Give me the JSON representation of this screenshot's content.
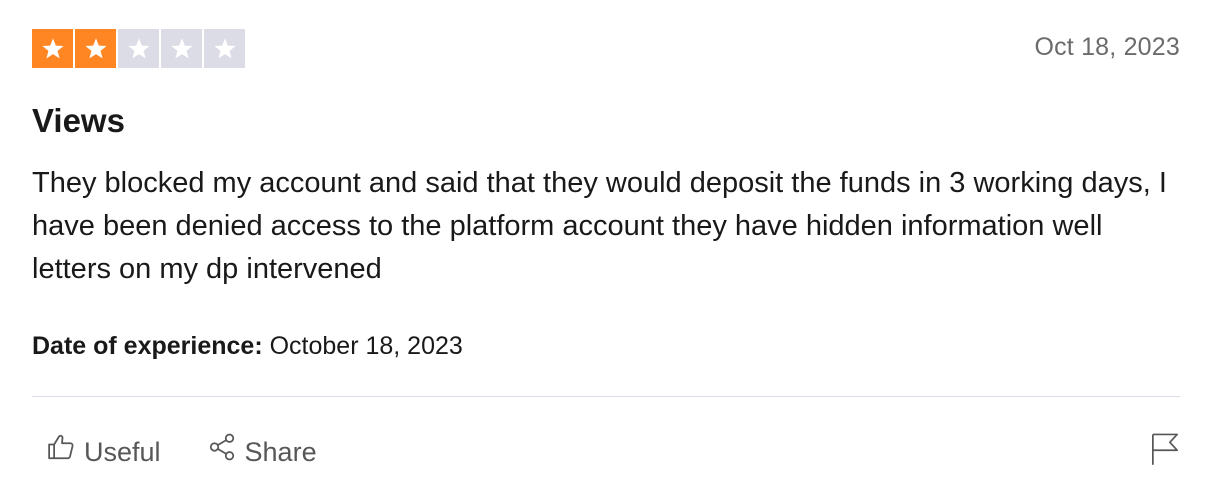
{
  "review": {
    "rating": 2,
    "max_rating": 5,
    "rating_icon": "star-icon",
    "colors": {
      "star_filled": "#FF8622",
      "star_empty": "#DCDCE6"
    },
    "date": "Oct 18, 2023",
    "title": "Views",
    "body": "They blocked my account and said that they would deposit the funds in 3 working days, I have been denied access to the platform account they have hidden information well letters on my dp intervened",
    "experience_label": "Date of experience:",
    "experience_date": "October 18, 2023"
  },
  "actions": {
    "useful_label": "Useful",
    "useful_icon": "thumbs-up-icon",
    "share_label": "Share",
    "share_icon": "share-icon",
    "report_icon": "flag-icon"
  }
}
